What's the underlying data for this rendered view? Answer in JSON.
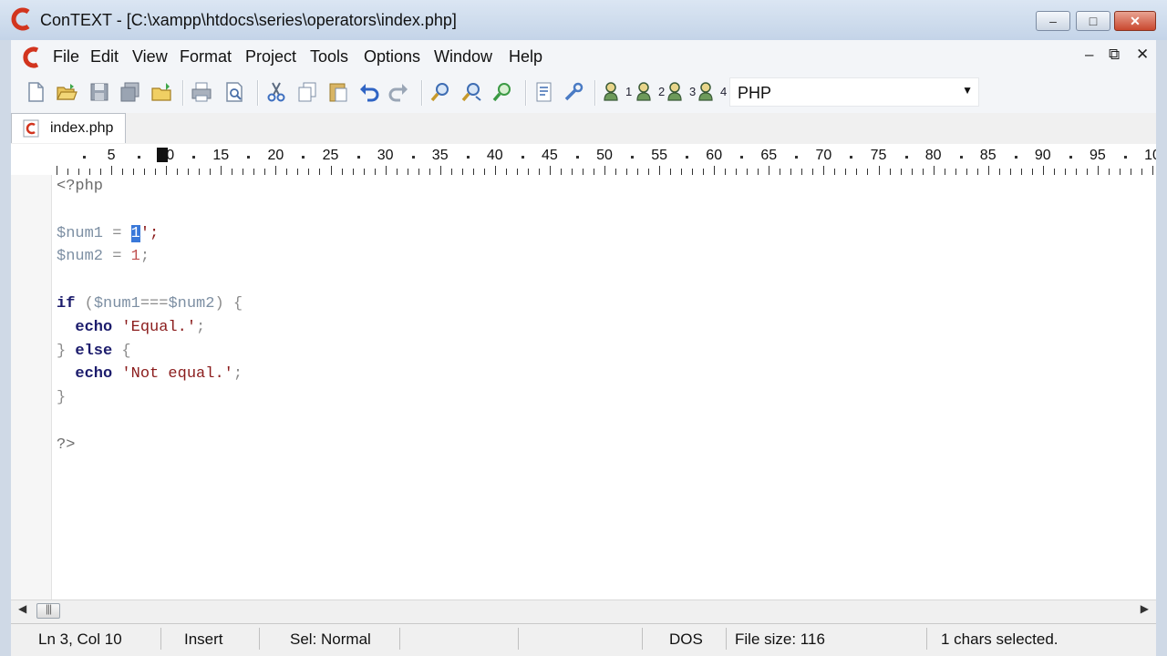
{
  "window": {
    "title": "ConTEXT - [C:\\xampp\\htdocs\\series\\operators\\index.php]",
    "minimize_glyph": "–",
    "maximize_glyph": "□",
    "close_glyph": "✕"
  },
  "menu": {
    "items": [
      "File",
      "Edit",
      "View",
      "Format",
      "Project",
      "Tools",
      "Options",
      "Window",
      "Help"
    ],
    "mdi_minimize": "–",
    "mdi_restore": "⧉",
    "mdi_close": "✕"
  },
  "toolbar": {
    "syntax_selected": "PHP",
    "user_commands": [
      "1",
      "2",
      "3",
      "4"
    ]
  },
  "tabs": [
    {
      "label": "index.php",
      "active": true
    }
  ],
  "ruler": {
    "labels": [
      "5",
      "10",
      "15",
      "20",
      "25",
      "30",
      "35",
      "40",
      "45",
      "50",
      "55",
      "60",
      "65",
      "70",
      "75",
      "80",
      "85",
      "90",
      "95",
      "10"
    ],
    "cursor_column": 10
  },
  "editor": {
    "lines": [
      "<?php",
      "",
      "$num1 = '1';",
      "$num2 = 1;",
      "",
      "if ($num1===$num2) {",
      "  echo 'Equal.';",
      "} else {",
      "  echo 'Not equal.';",
      "}",
      "",
      "?>"
    ],
    "selected_text": "1"
  },
  "statusbar": {
    "position": "Ln 3, Col 10",
    "mode": "Insert",
    "selection_mode": "Sel: Normal",
    "line_ending": "DOS",
    "file_size": "File size: 116",
    "chars_selected": "1 chars selected."
  },
  "colors": {
    "keyword": "#1c1c6c",
    "string": "#8b1c1c",
    "number": "#c05050",
    "variable": "#7d8fa3",
    "selection": "#3978d9"
  }
}
